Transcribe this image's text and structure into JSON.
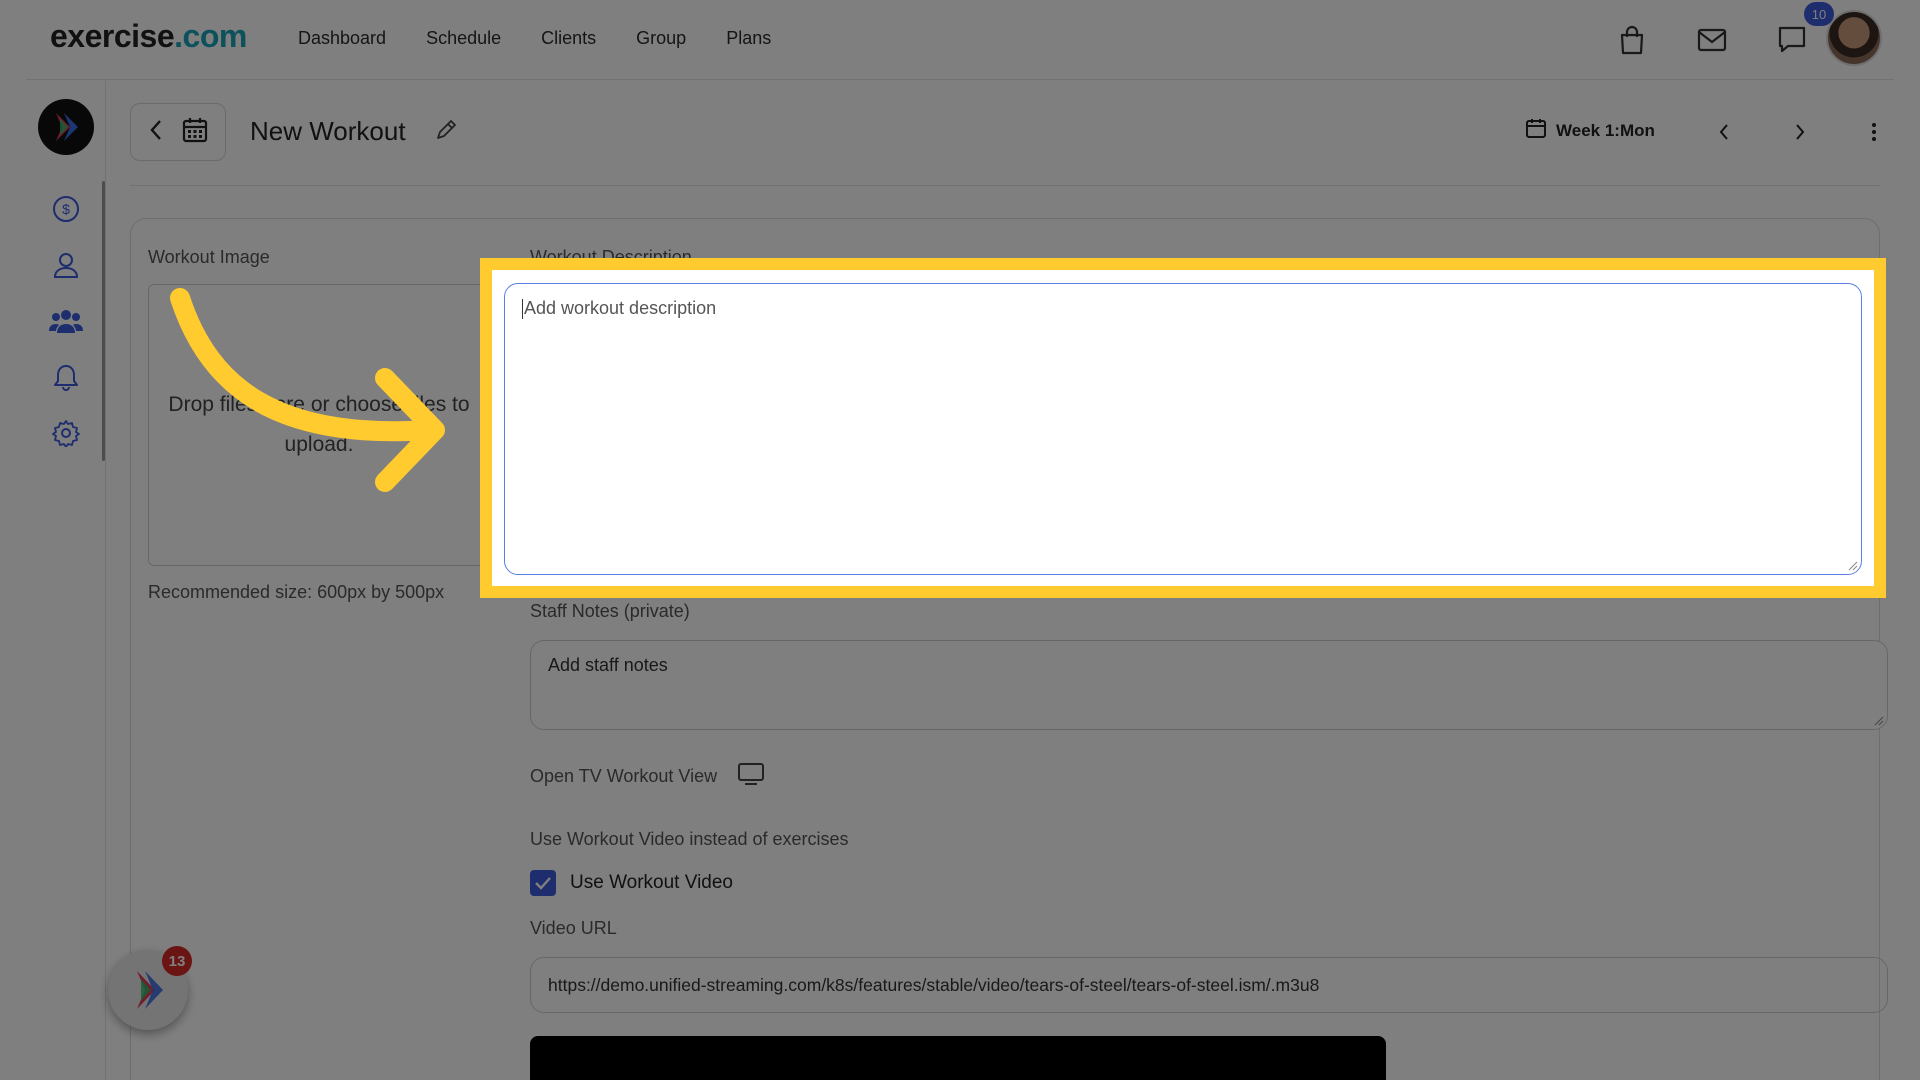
{
  "brand": {
    "name": "exercise",
    "suffix": ".com"
  },
  "nav": {
    "items": [
      "Dashboard",
      "Schedule",
      "Clients",
      "Group",
      "Plans"
    ]
  },
  "top_icons": {
    "chat_badge": "10"
  },
  "header": {
    "title": "New Workout",
    "week_label": "Week 1:Mon"
  },
  "workout_image": {
    "label": "Workout Image",
    "dropzone_text": "Drop files here or choose files to upload.",
    "recommended": "Recommended size: 600px by 500px"
  },
  "description": {
    "label": "Workout Description",
    "placeholder": "Add workout description"
  },
  "staff_notes": {
    "label": "Staff Notes (private)",
    "placeholder": "Add staff notes"
  },
  "tv_view": {
    "label": "Open TV Workout View"
  },
  "video": {
    "section_label": "Use Workout Video instead of exercises",
    "checkbox_label": "Use Workout Video",
    "checked": true,
    "url_label": "Video URL",
    "url_value": "https://demo.unified-streaming.com/k8s/features/stable/video/tears-of-steel/tears-of-steel.ism/.m3u8"
  },
  "fab": {
    "badge": "13"
  },
  "colors": {
    "accent": "#3b5bdb",
    "highlight": "#ffcb2f",
    "brand_dot": "#1aa3b8",
    "badge_red": "#d62828"
  },
  "icons": [
    "chevron-left-icon",
    "calendar-icon",
    "pencil-icon",
    "chevron-right-icon",
    "kebab-icon",
    "dollar-icon",
    "user-icon",
    "group-icon",
    "bell-icon",
    "gear-icon",
    "bag-icon",
    "mail-icon",
    "chat-icon",
    "tv-icon",
    "check-icon"
  ]
}
